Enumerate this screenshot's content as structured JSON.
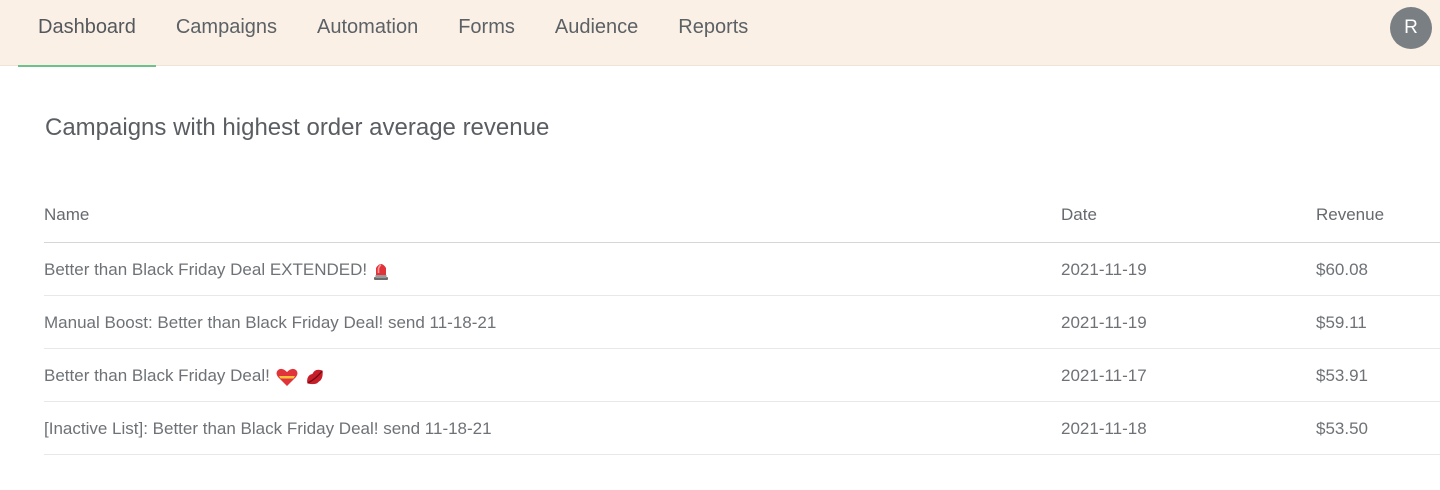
{
  "nav": {
    "tabs": [
      {
        "label": "Dashboard",
        "active": true
      },
      {
        "label": "Campaigns",
        "active": false
      },
      {
        "label": "Automation",
        "active": false
      },
      {
        "label": "Forms",
        "active": false
      },
      {
        "label": "Audience",
        "active": false
      },
      {
        "label": "Reports",
        "active": false
      }
    ],
    "avatar_initial": "R"
  },
  "section": {
    "title": "Campaigns with highest order average revenue"
  },
  "table": {
    "headers": {
      "name": "Name",
      "date": "Date",
      "revenue": "Revenue"
    },
    "rows": [
      {
        "name": "Better than Black Friday Deal EXTENDED!",
        "emoji": [
          "siren-icon"
        ],
        "date": "2021-11-19",
        "revenue": "$60.08"
      },
      {
        "name": "Manual Boost: Better than Black Friday Deal! send 11-18-21",
        "emoji": [],
        "date": "2021-11-19",
        "revenue": "$59.11"
      },
      {
        "name": "Better than Black Friday Deal!",
        "emoji": [
          "heart-icon",
          "lips-icon"
        ],
        "date": "2021-11-17",
        "revenue": "$53.91"
      },
      {
        "name": "[Inactive List]: Better than Black Friday Deal! send 11-18-21",
        "emoji": [],
        "date": "2021-11-18",
        "revenue": "$53.50"
      }
    ]
  },
  "colors": {
    "nav_bg": "#faf0e5",
    "active_underline": "#6cc28a",
    "avatar_bg": "#7a7f84"
  }
}
